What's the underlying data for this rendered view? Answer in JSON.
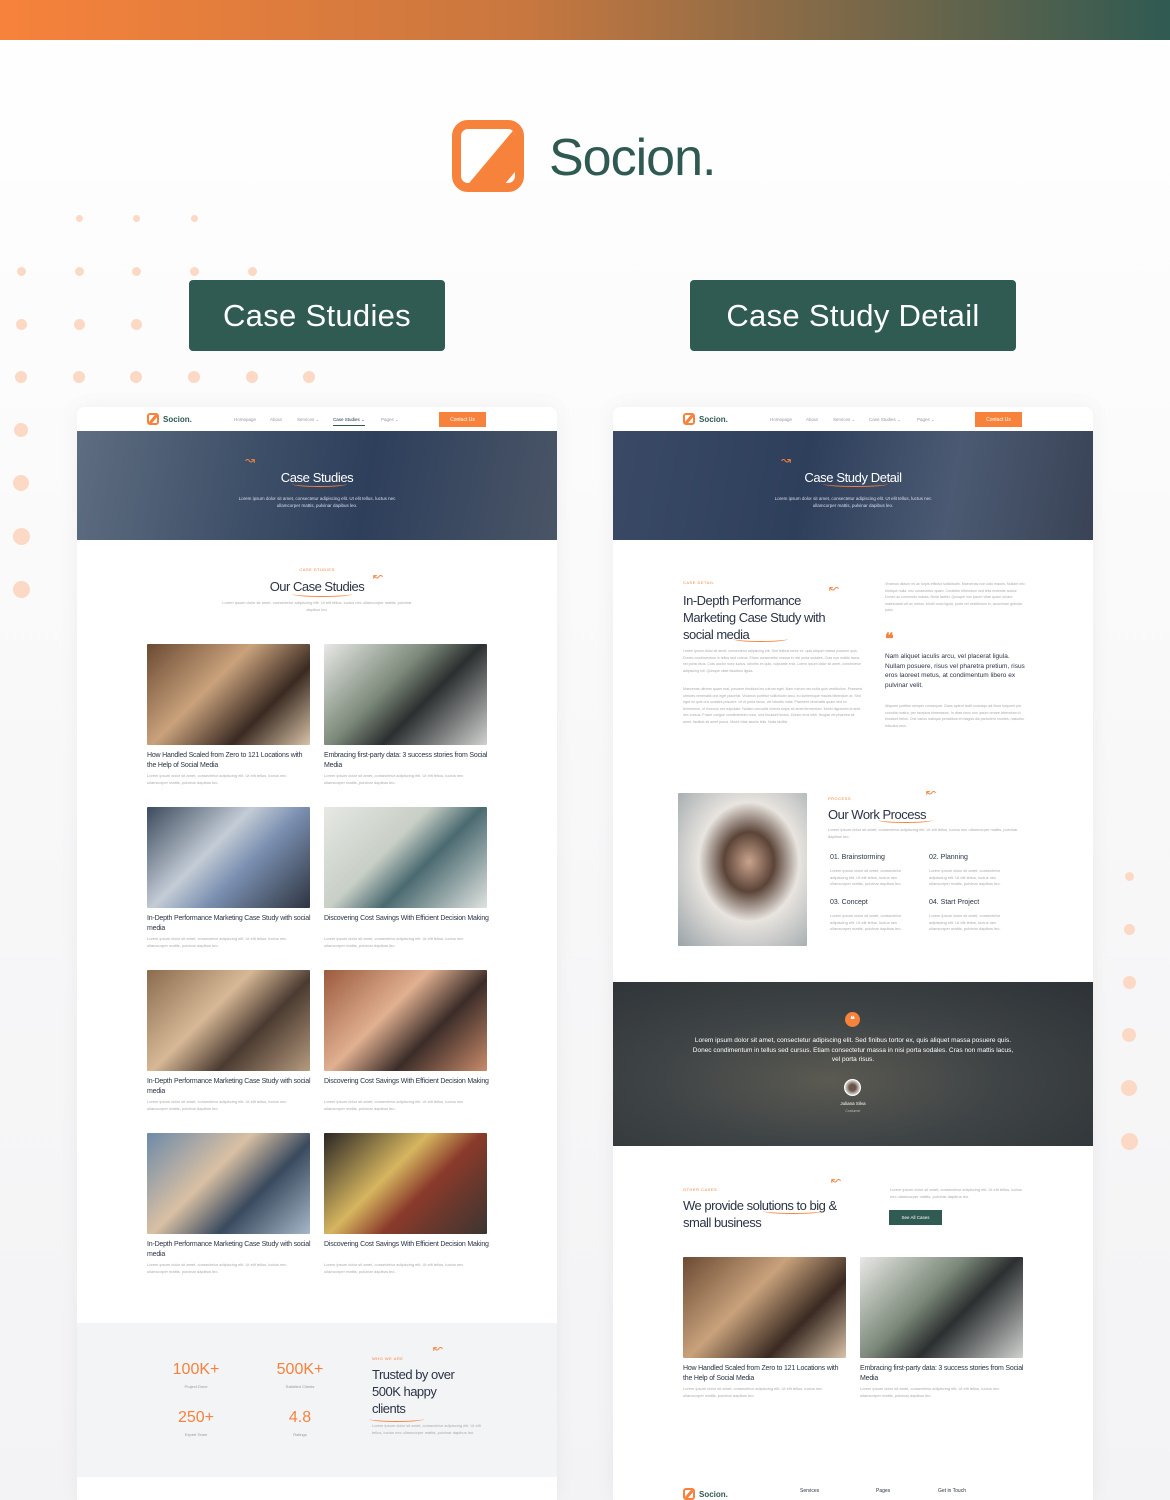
{
  "brand": {
    "name": "Socion.",
    "accent": "#f7823b",
    "primary": "#2f5a52"
  },
  "labels": {
    "left": "Case Studies",
    "right": "Case Study Detail"
  },
  "nav": {
    "logo": "Socion.",
    "items": [
      "Homepage",
      "About",
      "Services ⌄",
      "Case Studies ⌄",
      "Pages ⌄"
    ],
    "cta": "Contact Us"
  },
  "left": {
    "hero_title": "Case Studies",
    "hero_sub": "Lorem ipsum dolor sit amet, consectetur adipiscing elit. Ut elit tellus, luctus nec ullamcorper mattis, pulvinar dapibus leo.",
    "section_label": "CASE STUDIES",
    "section_title": "Our Case Studies",
    "section_sub": "Lorem ipsum dolor sit amet, consectetur adipiscing elit. Ut elit tellus, luctus nec ullamcorper mattis, pulvinar dapibus leo.",
    "cards": [
      {
        "title": "How Handled Scaled from Zero to 121 Locations with the Help of Social Media"
      },
      {
        "title": "Embracing first-party data: 3 success stories from Social Media"
      },
      {
        "title": "In-Depth Performance Marketing Case Study with social media"
      },
      {
        "title": "Discovering Cost Savings With Efficient Decision Making"
      },
      {
        "title": "In-Depth Performance Marketing Case Study with social media"
      },
      {
        "title": "Discovering Cost Savings With Efficient Decision Making"
      },
      {
        "title": "In-Depth Performance Marketing Case Study with social media"
      },
      {
        "title": "Discovering Cost Savings With Efficient Decision Making"
      }
    ],
    "card_desc": "Lorem ipsum dolor sit amet, consectetur adipiscing elit. Ut elit tellus, luctus nec ullamcorper mattis, pulvinar dapibus leo.",
    "stats": [
      {
        "value": "100K+",
        "label": "Project Done"
      },
      {
        "value": "500K+",
        "label": "Satisfied Clients"
      },
      {
        "value": "250+",
        "label": "Expert Team"
      },
      {
        "value": "4.8",
        "label": "Ratings"
      }
    ],
    "who_label": "WHO WE ARE",
    "who_title": "Trusted by over 500K happy clients",
    "who_text": "Lorem ipsum dolor sit amet, consectetur adipiscing elit. Ut elit tellus, luctus nec ullamcorper mattis, pulvinar dapibus leo."
  },
  "right": {
    "hero_title": "Case Study Detail",
    "hero_sub": "Lorem ipsum dolor sit amet, consectetur adipiscing elit. Ut elit tellus, luctus nec ullamcorper mattis, pulvinar dapibus leo.",
    "detail_label": "CASE DETAIL",
    "detail_title": "In-Depth Performance Marketing Case Study with social media",
    "para1": "Lorem ipsum dolor sit amet, consectetur adipiscing elit. Sed finibus tortor ex, quis aliquet massa posuere quis. Donec condimentum in tellus sed cursus. Etiam consectetur massa in nisi porta sodales. Cras non mattis lacus, vel porta risus. Cras auctor nunc luctus, lobortis ex quis, vulputate erat. Lorem ipsum dolor sit amet, consectetur adipiscing elit. Quisque vitae faucibus ligula.",
    "para2": "Maecenas ultrices quam erat, posuere tincidunt leo rutrum eget. Nam rutrum nec nulla quis vestibulum. Praesent ultricies venenatis orci eget placerat. Vivamus porttitor sollicitudin arcu, eu scelerisque mauris bibendum at. Sed eget mi quis orci sodales posuere. Ut et porta lacus, vel lobortis nulla. Praesent venenatis quam sed ex fermentum, ut rhoncus est vulputate. Nullam convallis viverra turpis sit amet fermentum. Morbi dignissim id ante nec cursus. Fusce congue condimentum nunc, sed tincidunt lectus. Donec eros nibh, feugiat vel pharetra sit amet, facilisis sit amet purus. Morbi vitae iaculis felis. Nulla facilisi.",
    "para3": "Vivamus dictum mi ac turpis efficitur sollicitudin. Maecenas non odio mauris. Nullam nec tristique nulla, nec consectetur quam. Curabitur bibendum sed felis molestie auctor. Donec ac commodo massa. Nulla facilisi. Quisque non ipsum vitae quam ornare malesuada vel ac metus. Morbi nunc ligula, porta vel vestibulum in, accumsan gravida justo.",
    "quote": "Nam aliquet iaculis arcu, vel placerat ligula. Nullam posuere, risus vel pharetra pretium, risus eros laoreet metus, at condimentum libero ex pulvinar velit.",
    "para4": "Aliquam porttitor semper consequat. Class aptent taciti sociosqu ad litora torquent per conubia nostra, per inceptos himenaeos. In vitae risus non ipsum ornare bibendum id tincidunt tellus. Orci varius natoque penatibus et magnis dis parturient montes, nascetur ridiculus mus.",
    "process_label": "PROCESS",
    "process_title": "Our Work Process",
    "process_sub": "Lorem ipsum dolor sit amet, consectetur adipiscing elit. Ut elit tellus, luctus nec ullamcorper mattis, pulvinar dapibus leo.",
    "steps": [
      {
        "title": "01. Brainstorming"
      },
      {
        "title": "02. Planning"
      },
      {
        "title": "03. Concept"
      },
      {
        "title": "04. Start Project"
      }
    ],
    "step_desc": "Lorem ipsum dolor sit amet, consectetur adipiscing elit. Ut elit tellus, luctus nec ullamcorper mattis, pulvinar dapibus leo.",
    "testimonial": {
      "text": "Lorem ipsum dolor sit amet, consectetur adipiscing elit. Sed finibus tortor ex, quis aliquet massa posuere quis. Donec condimentum in tellus sed cursus. Etiam consectetur massa in nisi porta sodales. Cras non mattis lacus, vel porta risus.",
      "name": "Juliana Silva",
      "role": "Costumer"
    },
    "other_label": "OTHER CASES",
    "other_title": "We provide solutions to big & small business",
    "other_text": "Lorem ipsum dolor sit amet, consectetur adipiscing elit. Ut elit tellus, luctus nec ullamcorper mattis, pulvinar dapibus leo.",
    "other_button": "See All Cases",
    "cards": [
      {
        "title": "How Handled Scaled from Zero to 121 Locations with the Help of Social Media"
      },
      {
        "title": "Embracing first-party data: 3 success stories from Social Media"
      }
    ],
    "footer": {
      "logo": "Socion.",
      "cols": [
        "Services",
        "Pages",
        "Get in Touch"
      ]
    }
  }
}
